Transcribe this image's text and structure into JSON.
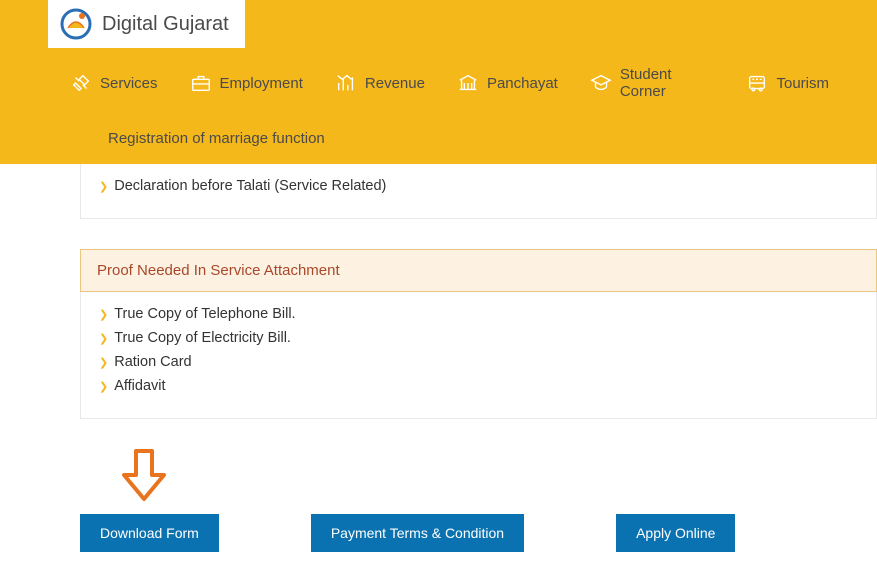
{
  "logo": {
    "text": "Digital Gujarat"
  },
  "nav": {
    "services": "Services",
    "employment": "Employment",
    "revenue": "Revenue",
    "panchayat": "Panchayat",
    "student_corner": "Student Corner",
    "tourism": "Tourism"
  },
  "breadcrumb": "Registration of marriage function",
  "section1_items": {
    "0": "Declaration before Talati (Service Related)"
  },
  "section2": {
    "title": "Proof Needed In Service Attachment",
    "items": {
      "0": "True Copy of Telephone Bill.",
      "1": "True Copy of Electricity Bill.",
      "2": "Ration Card",
      "3": "Affidavit"
    }
  },
  "buttons": {
    "download": "Download Form",
    "payment": "Payment Terms & Condition",
    "apply": "Apply Online"
  }
}
